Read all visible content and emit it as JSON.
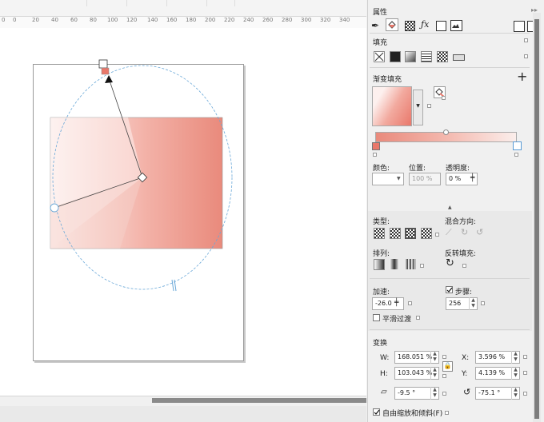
{
  "ruler": {
    "ticks": [
      "0",
      "20",
      "40",
      "60",
      "80",
      "100",
      "120",
      "140",
      "160",
      "180",
      "200",
      "220",
      "240",
      "260",
      "280",
      "300",
      "320",
      "340"
    ]
  },
  "panel": {
    "title": "属性",
    "fill_label": "填充",
    "gradient_fill_label": "渐变填充",
    "color_label": "颜色:",
    "position_label": "位置:",
    "position_value": "100 %",
    "transparency_label": "透明度:",
    "transparency_value": "0 %",
    "type_label": "类型:",
    "blend_label": "混合方向:",
    "arrange_label": "排列:",
    "reverse_label": "反转填充:",
    "accel_label": "加速:",
    "accel_value": "-26.0",
    "steps_label": "步骤:",
    "steps_value": "256",
    "smooth_label": "平滑过渡",
    "transform_label": "变换",
    "w_label": "W:",
    "w_value": "168.051 %",
    "h_label": "H:",
    "h_value": "103.043 %",
    "x_label": "X:",
    "x_value": "3.596 %",
    "y_label": "Y:",
    "y_value": "4.139 %",
    "skew_value": "-9.5 °",
    "rotate_value": "-75.1 °",
    "free_scale_label": "自由缩放和倾斜(F)"
  },
  "colors": {
    "accent": "#e9786b",
    "gradient_light": "#fbeeeb",
    "guide": "#6aa8d8"
  },
  "icons": {
    "pen": "pen-icon",
    "fill": "fill-bucket-icon",
    "transparency": "checker-icon",
    "fx": "fx-icon",
    "blank": "square-icon",
    "image": "image-icon",
    "plus": "plus-icon",
    "lock": "lock-icon"
  }
}
